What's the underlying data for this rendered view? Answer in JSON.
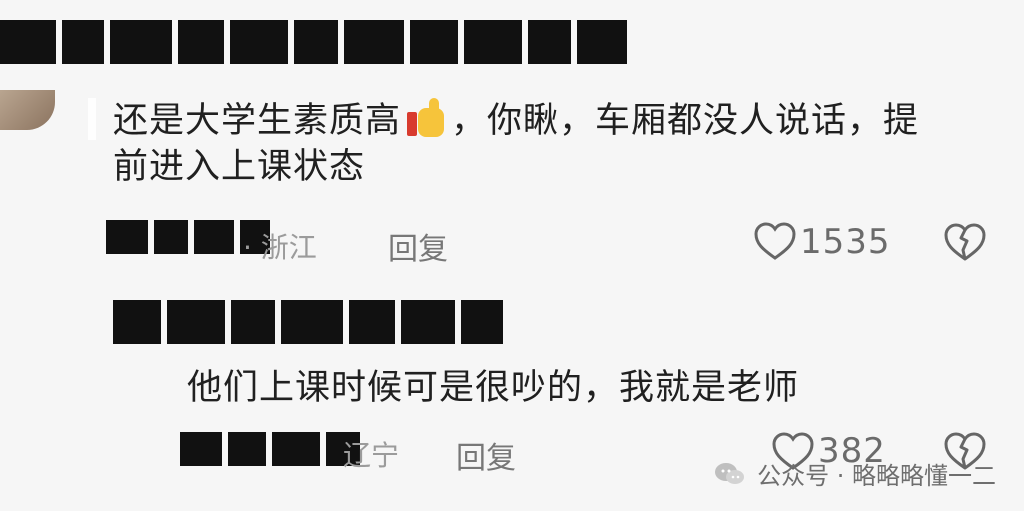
{
  "comments": [
    {
      "location": "· 浙江",
      "body_part1": "还是大学生素质高",
      "body_part2": "，你瞅，车厢都没人说话，提",
      "body_line2": "前进入上课状态",
      "reply_label": "回复",
      "likes": "1535",
      "emoji": "thumbs-up-icon"
    },
    {
      "location": "辽宁",
      "body": "他们上课时候可是很吵的，我就是老师",
      "reply_label": "回复",
      "likes": "382"
    }
  ],
  "watermark": {
    "text": "公众号 · 略略略懂一二",
    "icon": "wechat-icon"
  },
  "colors": {
    "background": "#f6f6f6",
    "text": "#202020",
    "meta": "#9b9b9b",
    "icon": "#6b6b6b"
  }
}
